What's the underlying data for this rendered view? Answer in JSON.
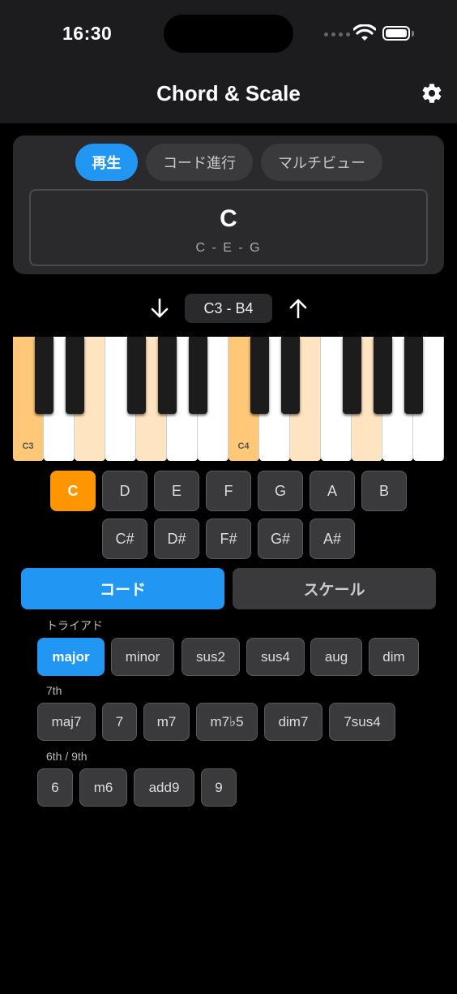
{
  "status_bar": {
    "time": "16:30"
  },
  "nav": {
    "title": "Chord & Scale"
  },
  "tabs": [
    {
      "label": "再生",
      "active": true
    },
    {
      "label": "コード進行",
      "active": false
    },
    {
      "label": "マルチビュー",
      "active": false
    }
  ],
  "display": {
    "chord": "C",
    "notes": "C - E - G"
  },
  "range": {
    "label": "C3 - B4"
  },
  "piano": {
    "highlight_color": "#ffc878",
    "light_color": "#ffe4c2",
    "white_keys": [
      {
        "note": "C",
        "label": "C3",
        "state": "root"
      },
      {
        "note": "D",
        "label": "",
        "state": "none"
      },
      {
        "note": "E",
        "label": "",
        "state": "tone"
      },
      {
        "note": "F",
        "label": "",
        "state": "none"
      },
      {
        "note": "G",
        "label": "",
        "state": "tone"
      },
      {
        "note": "A",
        "label": "",
        "state": "none"
      },
      {
        "note": "B",
        "label": "",
        "state": "none"
      },
      {
        "note": "C",
        "label": "C4",
        "state": "root"
      },
      {
        "note": "D",
        "label": "",
        "state": "none"
      },
      {
        "note": "E",
        "label": "",
        "state": "tone"
      },
      {
        "note": "F",
        "label": "",
        "state": "none"
      },
      {
        "note": "G",
        "label": "",
        "state": "tone"
      },
      {
        "note": "A",
        "label": "",
        "state": "none"
      },
      {
        "note": "B",
        "label": "",
        "state": "none"
      }
    ]
  },
  "root_notes": {
    "naturals": [
      "C",
      "D",
      "E",
      "F",
      "G",
      "A",
      "B"
    ],
    "accidentals": [
      "C#",
      "D#",
      "F#",
      "G#",
      "A#"
    ],
    "selected": "C"
  },
  "mode": {
    "chord_label": "コード",
    "scale_label": "スケール",
    "active": "chord"
  },
  "chord_types": {
    "triad": {
      "label": "トライアド",
      "items": [
        "major",
        "minor",
        "sus2",
        "sus4",
        "aug",
        "dim"
      ]
    },
    "seventh": {
      "label": "7th",
      "items": [
        "maj7",
        "7",
        "m7",
        "m7♭5",
        "dim7",
        "7sus4"
      ]
    },
    "sixth_ninth": {
      "label": "6th / 9th",
      "items": [
        "6",
        "m6",
        "add9",
        "9"
      ]
    },
    "selected": "major"
  }
}
